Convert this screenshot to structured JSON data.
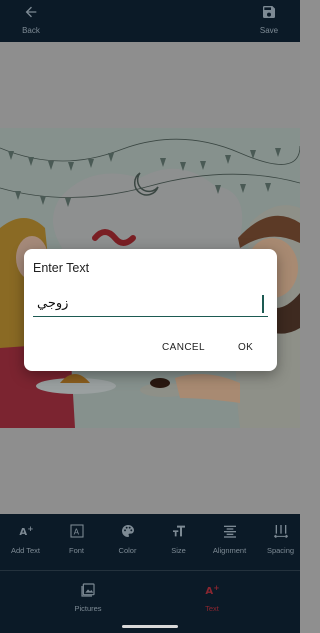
{
  "topbar": {
    "back_label": "Back",
    "save_label": "Save",
    "back_icon": "arrow-left-icon",
    "save_icon": "floppy-disk-icon"
  },
  "dialog": {
    "title": "Enter Text",
    "input_value": "زوجي",
    "cancel_label": "CANCEL",
    "ok_label": "OK"
  },
  "tools": [
    {
      "label": "Add Text",
      "icon": "add-text-icon"
    },
    {
      "label": "Font",
      "icon": "font-icon"
    },
    {
      "label": "Color",
      "icon": "palette-icon"
    },
    {
      "label": "Size",
      "icon": "text-size-icon"
    },
    {
      "label": "Alignment",
      "icon": "align-center-icon"
    },
    {
      "label": "Spacing",
      "icon": "spacing-icon"
    }
  ],
  "bottom_nav": {
    "pictures_label": "Pictures",
    "text_label": "Text",
    "active": "Text",
    "active_color": "#8a2630"
  },
  "colors": {
    "bar_background": "#0b1a27",
    "scrim": "#8e8e8e",
    "accent": "#1d5a52"
  }
}
